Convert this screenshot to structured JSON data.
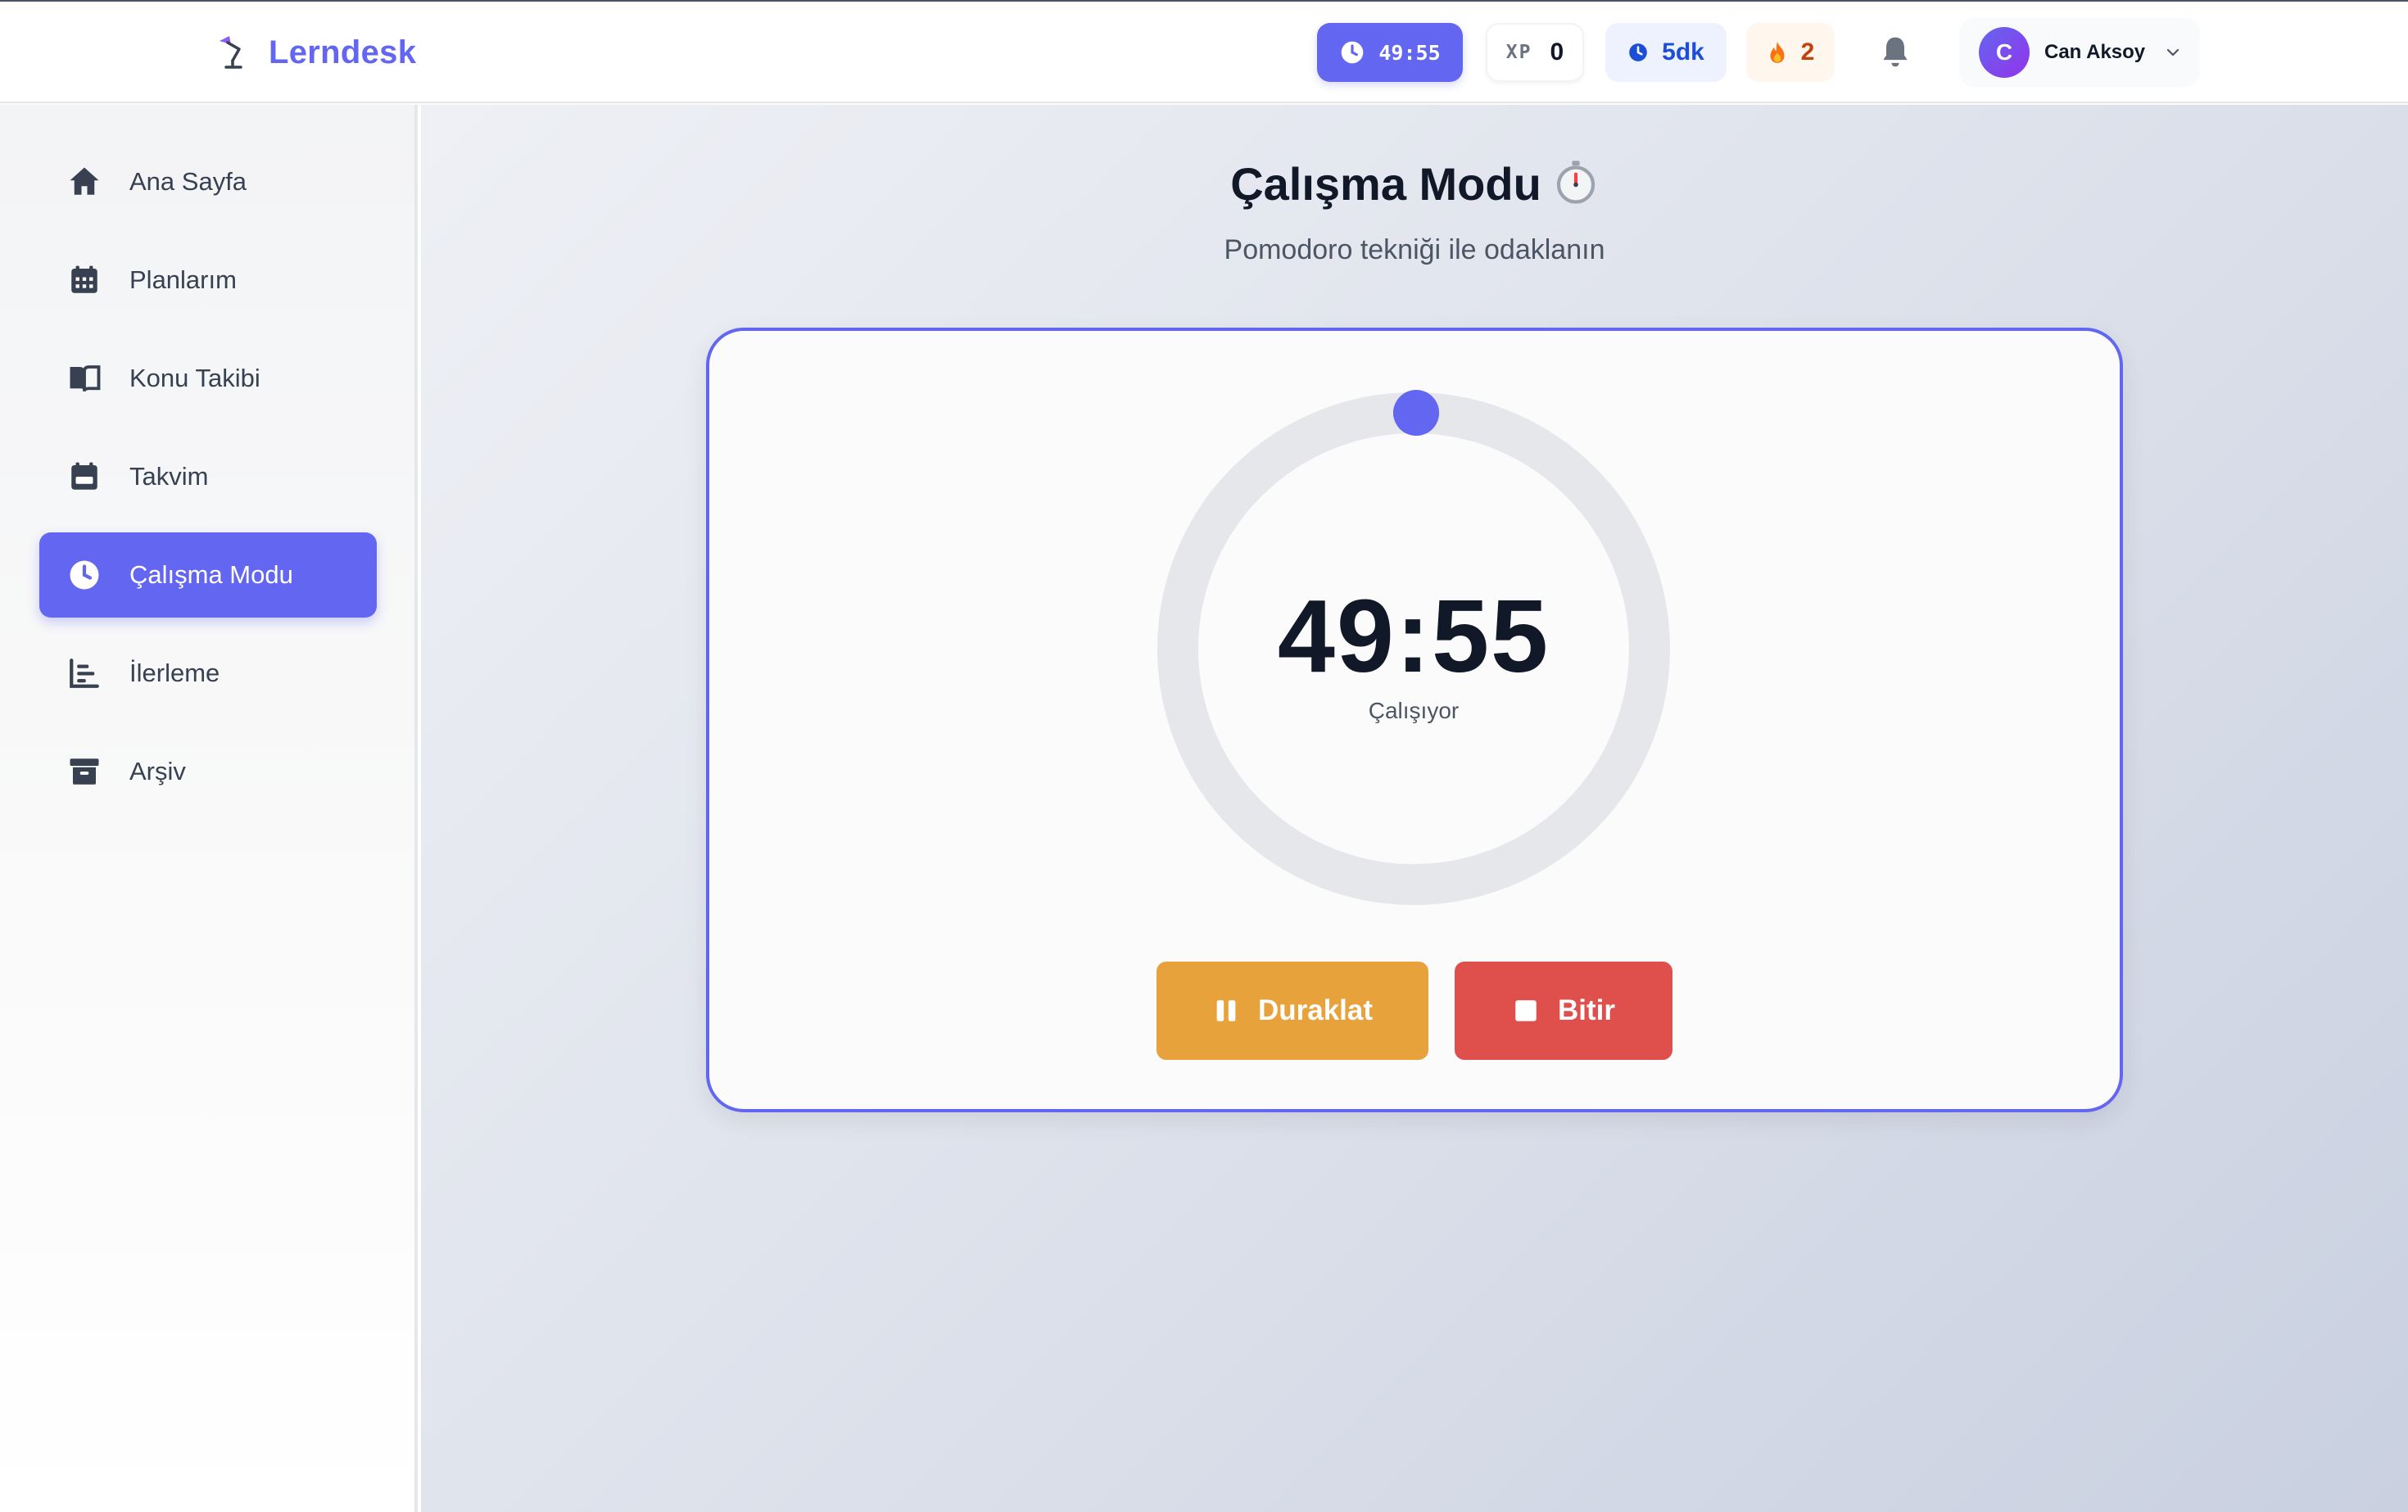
{
  "header": {
    "brand": "Lerndesk",
    "timer_pill": "49:55",
    "xp_label": "XP",
    "xp_value": "0",
    "minutes_pill": "5dk",
    "streak_value": "2",
    "user_initial": "C",
    "user_name": "Can Aksoy"
  },
  "sidebar": {
    "items": [
      {
        "label": "Ana Sayfa",
        "icon": "home-icon"
      },
      {
        "label": "Planlarım",
        "icon": "calendar-grid-icon"
      },
      {
        "label": "Konu Takibi",
        "icon": "book-icon"
      },
      {
        "label": "Takvim",
        "icon": "calendar-icon"
      },
      {
        "label": "Çalışma Modu",
        "icon": "clock-icon",
        "active": true
      },
      {
        "label": "İlerleme",
        "icon": "chart-icon"
      },
      {
        "label": "Arşiv",
        "icon": "archive-icon"
      }
    ]
  },
  "main": {
    "title": "Çalışma Modu",
    "subtitle": "Pomodoro tekniği ile odaklanın",
    "timer": {
      "time": "49:55",
      "state": "Çalışıyor",
      "progress": 0.0017
    },
    "buttons": {
      "pause_label": "Duraklat",
      "stop_label": "Bitir"
    }
  },
  "colors": {
    "accent": "#6366f1",
    "pause": "#e8a23b",
    "stop": "#df4f4b"
  }
}
